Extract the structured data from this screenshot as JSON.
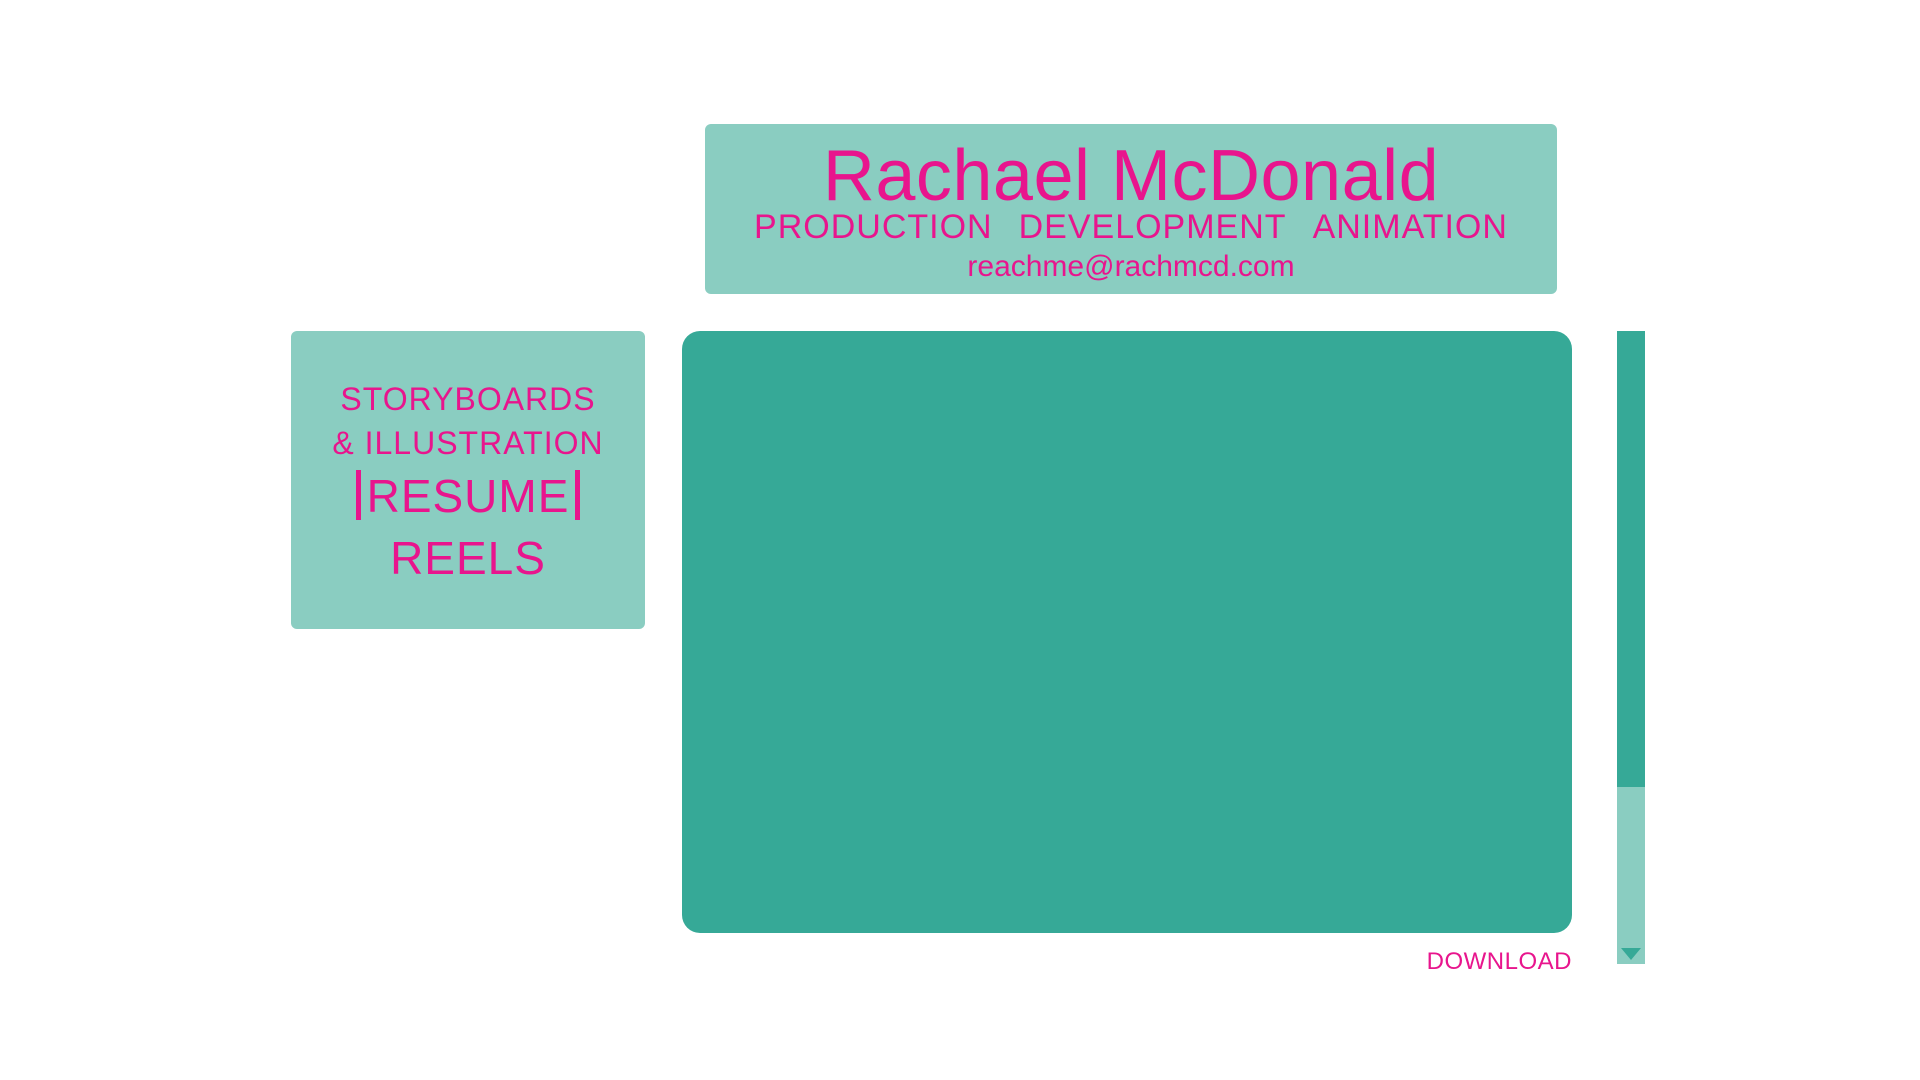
{
  "header": {
    "name": "Rachael McDonald",
    "roles": [
      "PRODUCTION",
      "DEVELOPMENT",
      "ANIMATION"
    ],
    "email": "reachme@rachmcd.com"
  },
  "nav": {
    "storyboards_line1": "STORYBOARDS",
    "storyboards_line2": "& ILLUSTRATION",
    "resume": "RESUME",
    "reels": "REELS"
  },
  "main": {
    "download_label": "DOWNLOAD"
  },
  "scrollbar": {
    "thumb_fraction": 0.72
  },
  "colors": {
    "accent_pink": "#e8158d",
    "teal_light": "#8acdc1",
    "teal_dark": "#36a997"
  },
  "icons": {
    "scroll_down": "chevron-down-icon"
  }
}
